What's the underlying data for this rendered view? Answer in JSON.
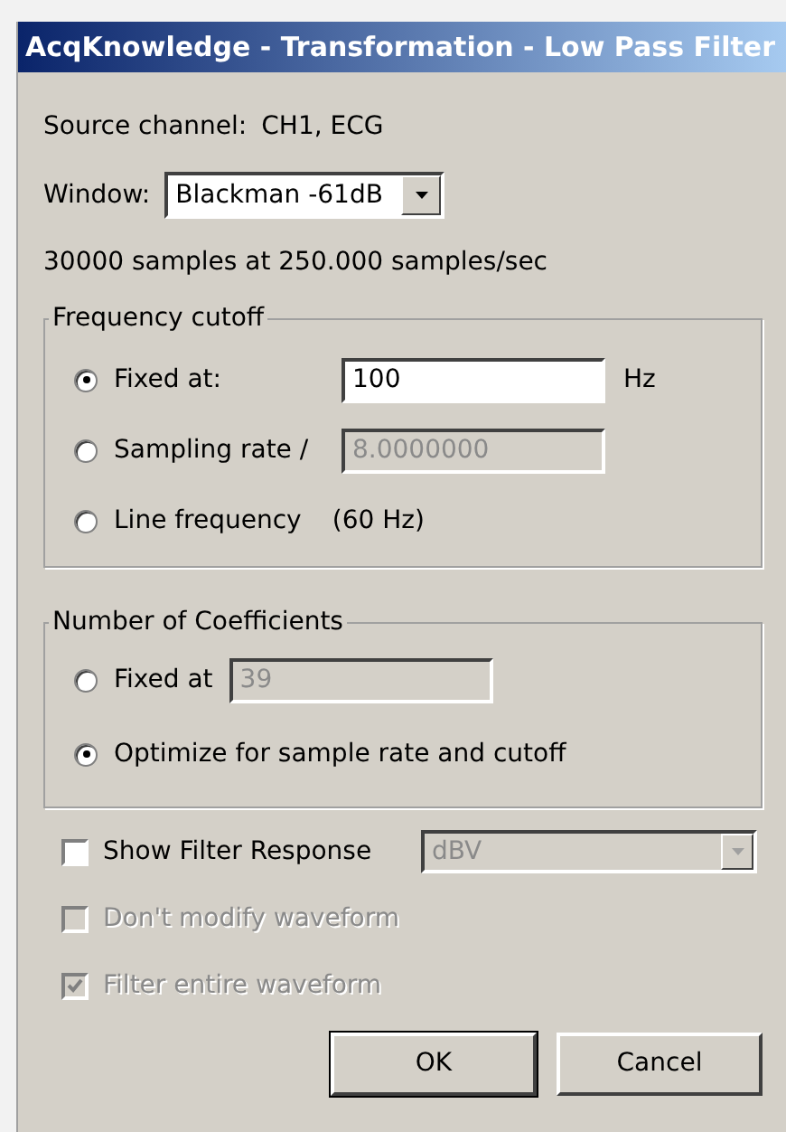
{
  "window": {
    "title": "AcqKnowledge - Transformation - Low Pass Filter"
  },
  "source_channel": {
    "label": "Source channel:",
    "value": "CH1, ECG"
  },
  "window_select": {
    "label": "Window:",
    "value": "Blackman -61dB"
  },
  "samples_info": "30000 samples at 250.000 samples/sec",
  "groups": [
    {
      "title": "Frequency cutoff",
      "options": [
        {
          "label": "Fixed at:",
          "selected": true,
          "field": {
            "value": "100",
            "disabled": false
          },
          "unit": "Hz"
        },
        {
          "label": "Sampling rate /",
          "selected": false,
          "field": {
            "value": "8.0000000",
            "disabled": true
          }
        },
        {
          "label": "Line frequency",
          "selected": false,
          "note": "(60 Hz)"
        }
      ]
    },
    {
      "title": "Number of Coefficients",
      "options": [
        {
          "label": "Fixed at",
          "selected": false,
          "field": {
            "value": "39",
            "disabled": true
          }
        },
        {
          "label": "Optimize for sample rate and cutoff",
          "selected": true
        }
      ]
    }
  ],
  "checkboxes": [
    {
      "label": "Show Filter Response",
      "checked": false,
      "disabled": false,
      "select": {
        "value": "dBV",
        "disabled": true
      }
    },
    {
      "label": "Don't modify waveform",
      "checked": false,
      "disabled": true
    },
    {
      "label": "Filter entire waveform",
      "checked": true,
      "disabled": true
    }
  ],
  "buttons": [
    {
      "label": "OK",
      "default": true
    },
    {
      "label": "Cancel",
      "default": false
    }
  ]
}
